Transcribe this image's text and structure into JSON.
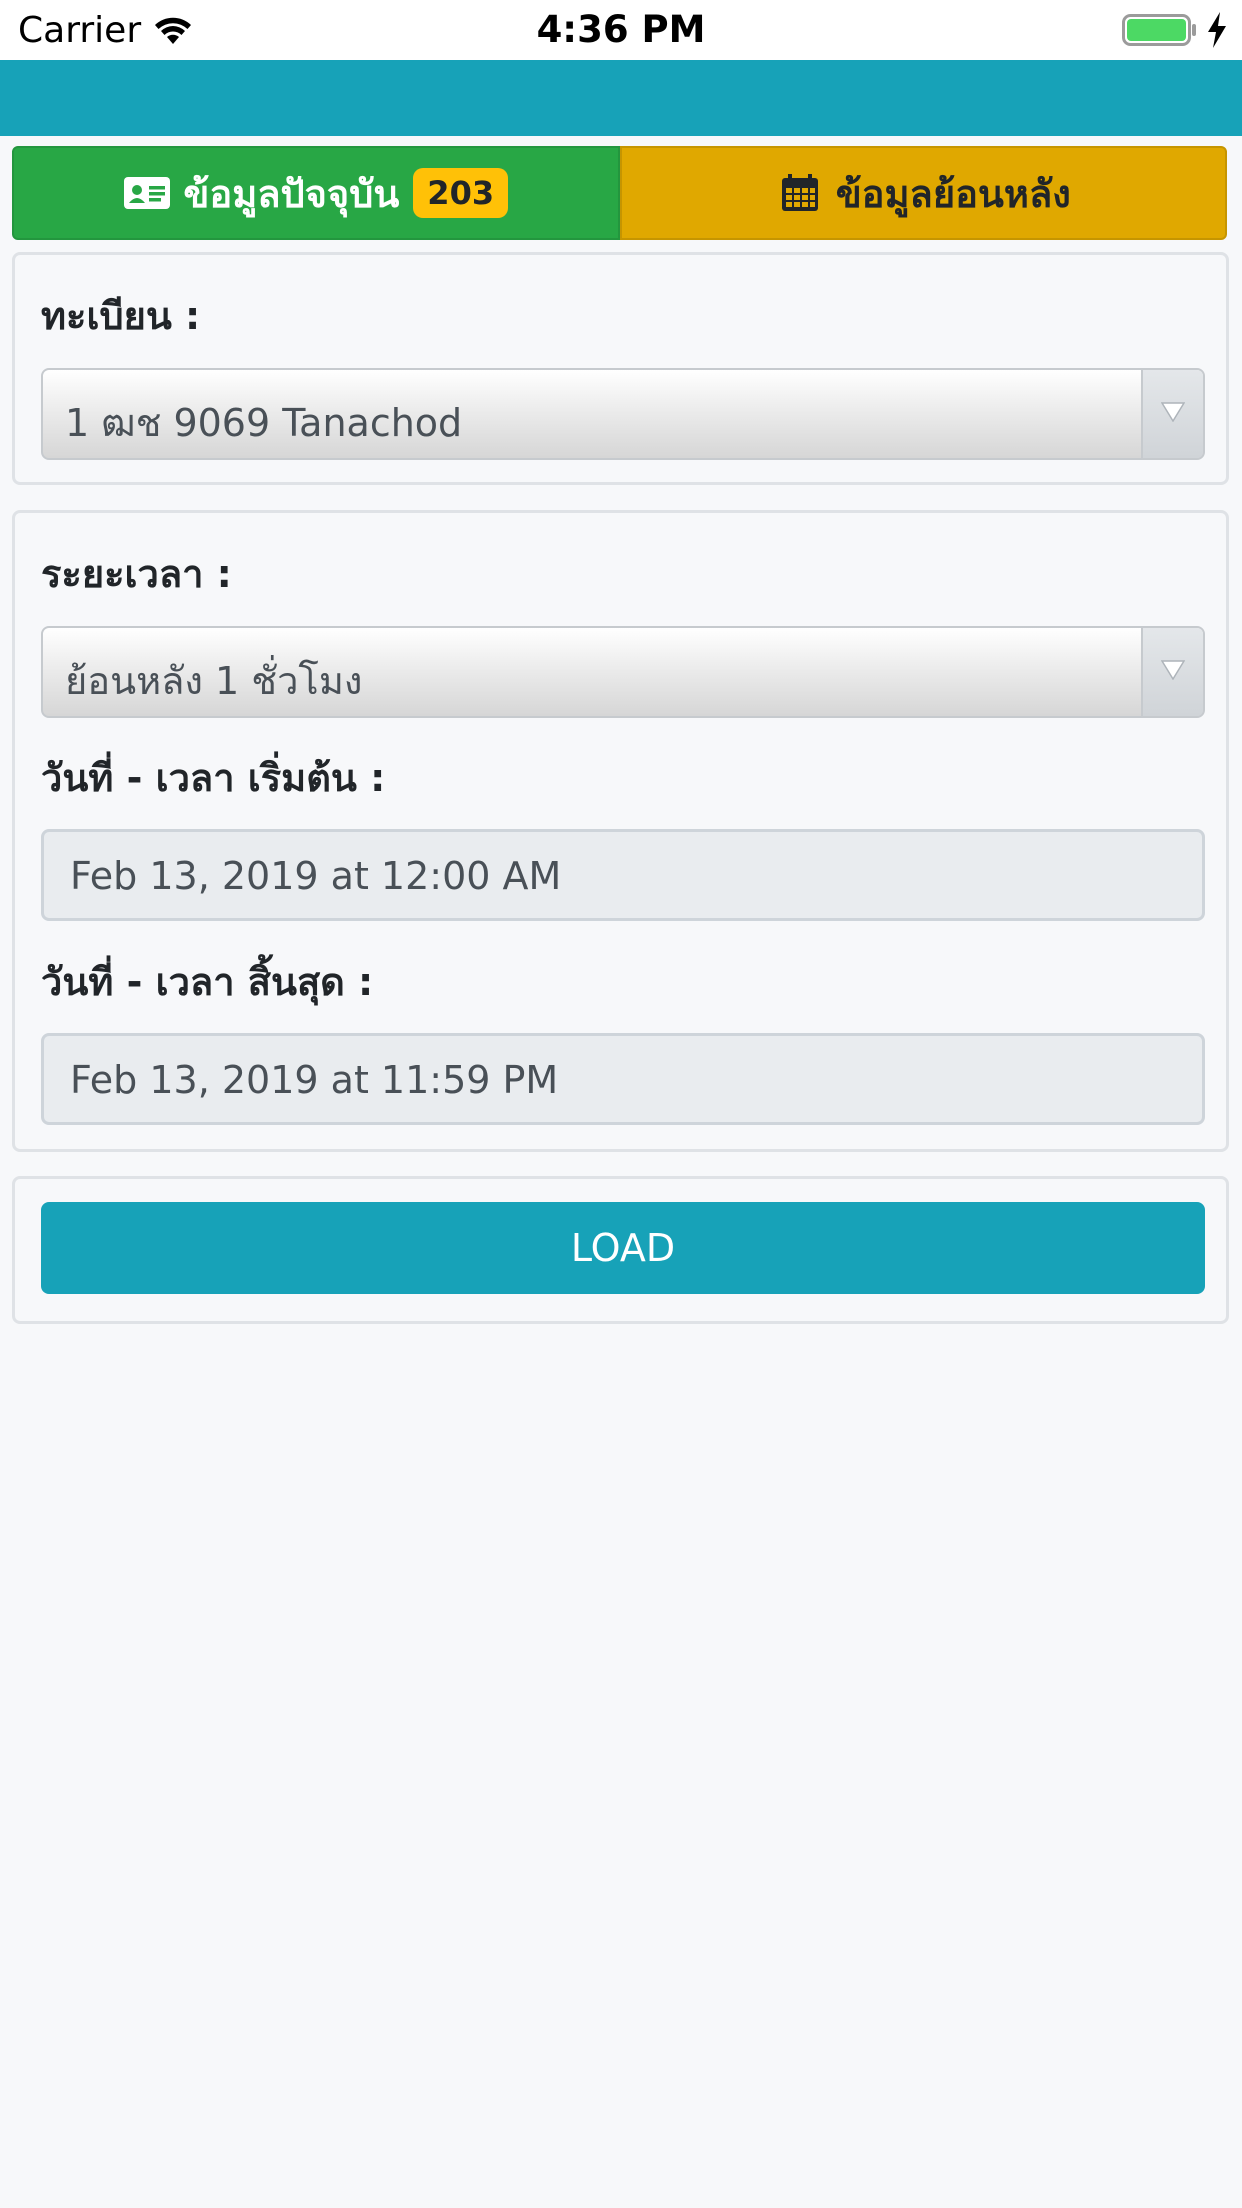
{
  "status_bar": {
    "carrier": "Carrier",
    "time": "4:36 PM",
    "icons": [
      "wifi-icon",
      "battery-icon",
      "charging-bolt-icon"
    ]
  },
  "tabs": {
    "current": {
      "label": "ข้อมูลปัจจุบัน",
      "badge": "203",
      "icon": "id-card-icon",
      "color": "#28a745"
    },
    "history": {
      "label": "ข้อมูลย้อนหลัง",
      "icon": "calendar-icon",
      "color": "#e0a800"
    }
  },
  "plate": {
    "label": "ทะเบียน :",
    "selected": "1 ฒช 9069 Tanachod"
  },
  "period": {
    "label": "ระยะเวลา :",
    "selected": "ย้อนหลัง 1 ชั่วโมง",
    "start_label": "วันที่ - เวลา เริ่มต้น :",
    "start_value": "Feb 13, 2019 at 12:00 AM",
    "end_label": "วันที่ - เวลา สิ้นสุด :",
    "end_value": "Feb 13, 2019 at 11:59 PM"
  },
  "load_button": {
    "label": "LOAD",
    "color": "#17a2b8"
  }
}
